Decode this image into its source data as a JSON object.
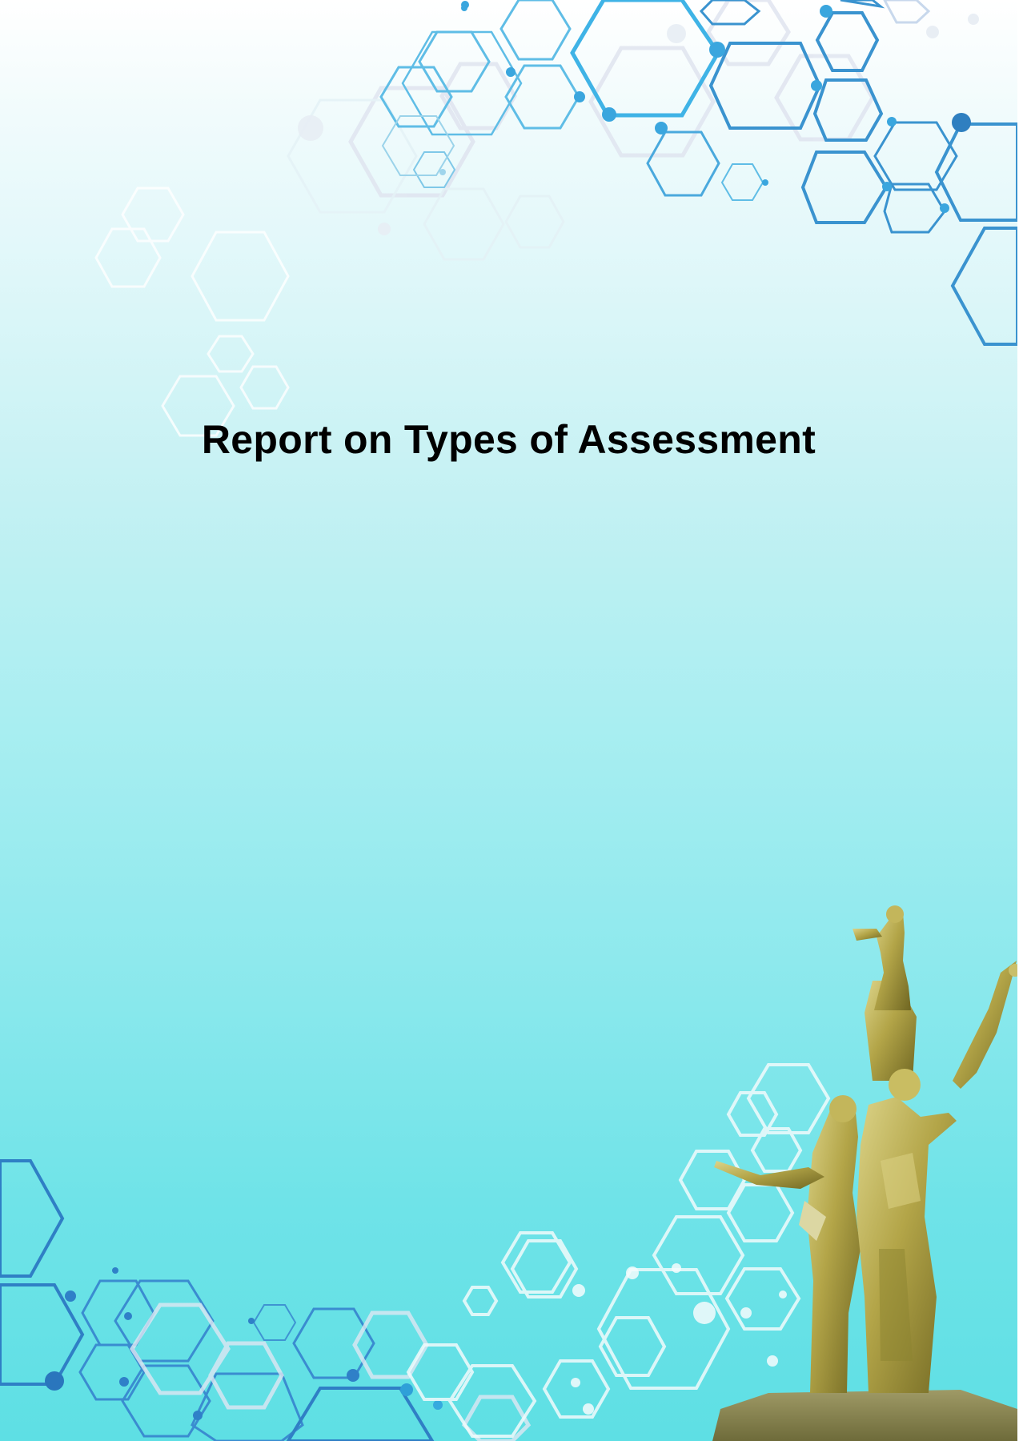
{
  "document": {
    "title": "Report on Types of Assessment"
  },
  "colors": {
    "accent_blue": "#2f86c9",
    "accent_light": "#4fc0e6",
    "faint_white": "#ffffff",
    "background_top": "#ffffff",
    "background_bottom": "#5edfe4"
  },
  "decorations": {
    "top_pattern": "hexagon-molecule-pattern",
    "bottom_pattern": "hexagon-molecule-pattern",
    "illustration": "golden-statue-monument"
  }
}
